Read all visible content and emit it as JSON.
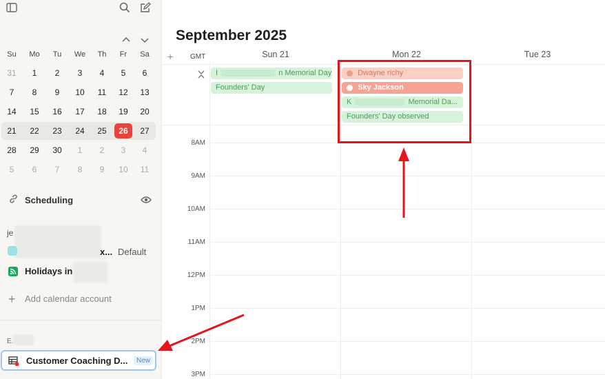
{
  "calendar": {
    "weekdays": [
      "Su",
      "Mo",
      "Tu",
      "We",
      "Th",
      "Fr",
      "Sa"
    ],
    "weeks": [
      [
        "31",
        "1",
        "2",
        "3",
        "4",
        "5",
        "6"
      ],
      [
        "7",
        "8",
        "9",
        "10",
        "11",
        "12",
        "13"
      ],
      [
        "14",
        "15",
        "16",
        "17",
        "18",
        "19",
        "20"
      ],
      [
        "21",
        "22",
        "23",
        "24",
        "25",
        "26",
        "27"
      ],
      [
        "28",
        "29",
        "30",
        "1",
        "2",
        "3",
        "4"
      ],
      [
        "5",
        "6",
        "7",
        "8",
        "9",
        "10",
        "11"
      ]
    ]
  },
  "sidebar": {
    "scheduling_label": "Scheduling",
    "account_prefix": "je",
    "calendar_name_fragment": "x...",
    "default_label": "Default",
    "holidays_label": "Holidays in (",
    "add_account_label": "Add calendar account",
    "section_prefix": "E...",
    "db_item_label": "Customer Coaching D...",
    "new_badge": "New"
  },
  "main": {
    "month_title": "September 2025",
    "plus_label": "+",
    "tz_label": "GMT",
    "days": [
      "Sun 21",
      "Mon 22",
      "Tue 23"
    ],
    "hours": [
      "8AM",
      "9AM",
      "10AM",
      "11AM",
      "12PM",
      "1PM",
      "2PM",
      "3PM"
    ],
    "events": {
      "sun_1_prefix": "I",
      "sun_1_suffix": "n Memorial Day",
      "sun_2": "Founders' Day",
      "mon_1": "Dwayne richy",
      "mon_2": "Sky Jackson",
      "mon_3_prefix": "K",
      "mon_3_suffix": "Memorial Da...",
      "mon_4": "Founders' Day observed"
    }
  },
  "colors": {
    "today": "#e8433d",
    "annotation": "#e6141b",
    "event_green": "#d6f2da",
    "event_salmon": "#fbd0c4"
  }
}
